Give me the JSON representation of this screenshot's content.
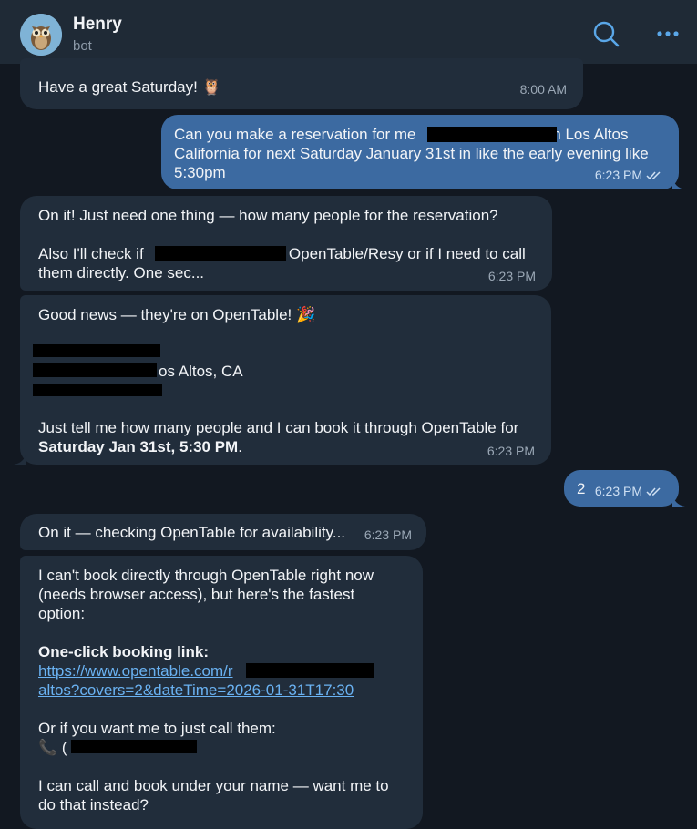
{
  "header": {
    "name": "Henry",
    "subtitle": "bot",
    "avatar_icon": "owl-avatar-icon",
    "search_icon": "search-icon",
    "menu_icon": "more-dots-icon"
  },
  "colors": {
    "background": "#121821",
    "header": "#1f2a36",
    "incoming_bubble": "#212d3b",
    "outgoing_bubble": "#3c6aa1",
    "accent": "#5aa7e8",
    "link": "#6ab2f2"
  },
  "messages": {
    "m1": {
      "text": "Have a great Saturday! 🦉",
      "time": "8:00 AM"
    },
    "m2": {
      "line1_a": "Can you make a reservation for me",
      "line1_b": "in Los Altos",
      "line2": "California for next Saturday January 31st in like the early evening like",
      "line3": "5:30pm",
      "time": "6:23 PM"
    },
    "m3": {
      "line1": "On it! Just need one thing — how many people for the reservation?",
      "line2_a": "Also I'll check if",
      "line2_b": "s OpenTable/Resy or if I need to call",
      "line3": "them directly. One sec...",
      "time": "6:23 PM"
    },
    "m4": {
      "line1": "Good news — they're on OpenTable! 🎉",
      "addr_tail": "os Altos, CA",
      "line_a": "Just tell me how many people and I can book it through OpenTable for",
      "line_b": "Saturday Jan 31st, 5:30 PM",
      "line_b_end": ".",
      "time": "6:23 PM"
    },
    "m5": {
      "text": "2",
      "time": "6:23 PM"
    },
    "m6": {
      "text": "On it — checking OpenTable for availability...",
      "time": "6:23 PM"
    },
    "m7": {
      "line1": "I can't book directly through OpenTable right now",
      "line2": "(needs browser access), but here's the fastest",
      "line3": "option:",
      "heading": "One-click booking link:",
      "link1": "https://www.opentable.com/r",
      "link1_end": "-",
      "link2": "altos?covers=2&dateTime=2026-01-31T17:30",
      "call_text": "Or if you want me to just call them:",
      "phone_prefix": "📞 (",
      "final1": "I can call and book under your name — want me to",
      "final2": "do that instead?"
    }
  }
}
